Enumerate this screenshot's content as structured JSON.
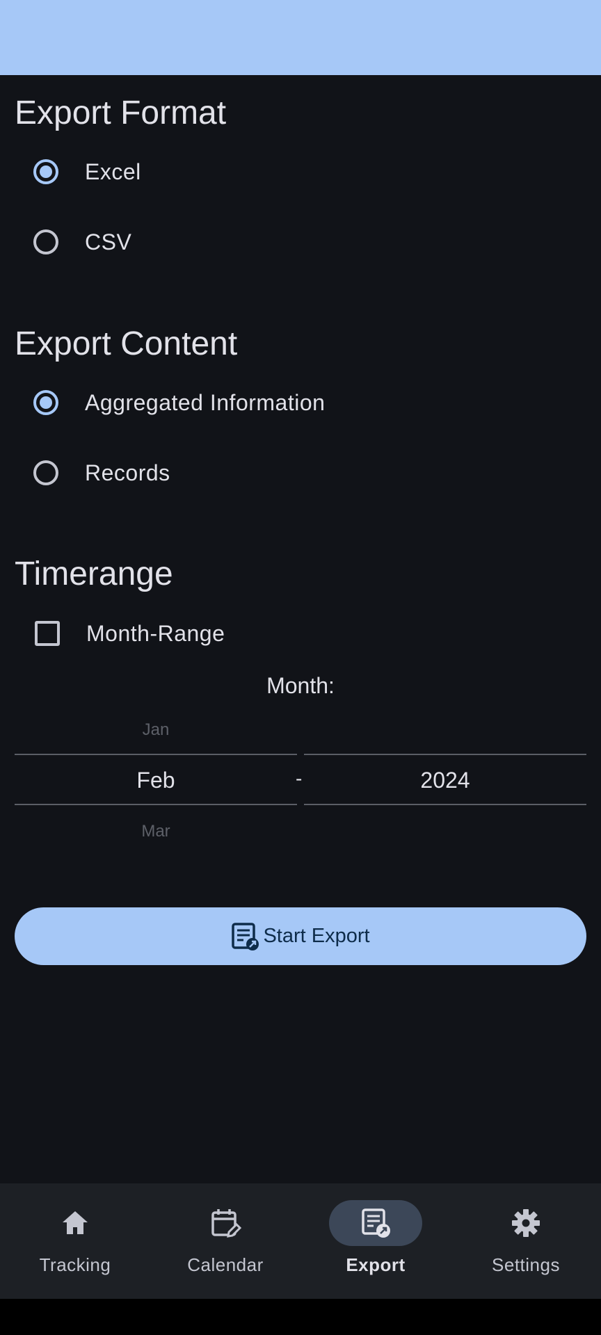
{
  "export_format": {
    "title": "Export Format",
    "options": [
      {
        "label": "Excel",
        "selected": true
      },
      {
        "label": "CSV",
        "selected": false
      }
    ]
  },
  "export_content": {
    "title": "Export Content",
    "options": [
      {
        "label": "Aggregated Information",
        "selected": true
      },
      {
        "label": "Records",
        "selected": false
      }
    ]
  },
  "timerange": {
    "title": "Timerange",
    "month_range_label": "Month-Range",
    "month_range_checked": false,
    "month_label": "Month:",
    "month_picker": {
      "prev": "Jan",
      "selected": "Feb",
      "next": "Mar"
    },
    "separator": "-",
    "year_picker": {
      "selected": "2024"
    }
  },
  "start_export_button": {
    "label": "Start Export"
  },
  "nav": {
    "items": [
      {
        "label": "Tracking",
        "icon": "home-icon",
        "active": false
      },
      {
        "label": "Calendar",
        "icon": "calendar-edit-icon",
        "active": false
      },
      {
        "label": "Export",
        "icon": "export-document-icon",
        "active": true
      },
      {
        "label": "Settings",
        "icon": "gear-icon",
        "active": false
      }
    ]
  },
  "colors": {
    "accent": "#a6c8f7",
    "background": "#111318",
    "navbar": "#1d2025",
    "active_pill": "#3c4758"
  }
}
